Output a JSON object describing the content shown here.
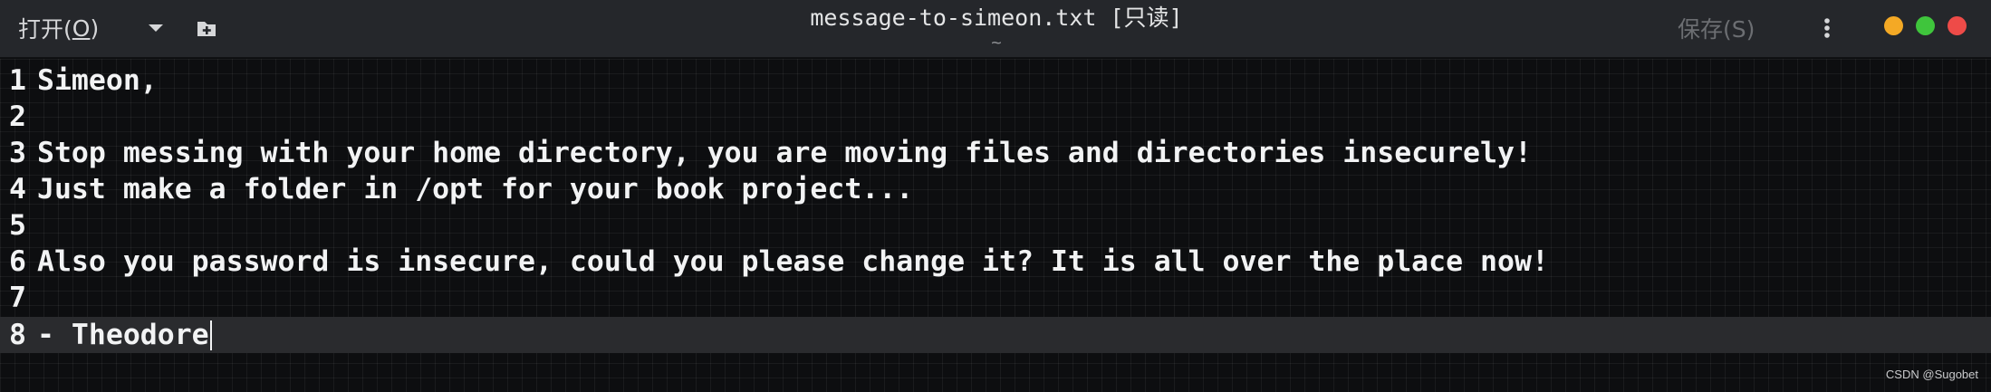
{
  "header": {
    "open_label_prefix": "打开(",
    "open_label_mnemonic": "O",
    "open_label_suffix": ")",
    "dropdown_icon": "chevron-down-icon",
    "new_tab_icon": "new-document-icon",
    "title": "message-to-simeon.txt [只读]",
    "subtitle": "~",
    "save_label": "保存(S)",
    "menu_icon": "vertical-ellipsis-icon"
  },
  "window_controls": {
    "minimize_color": "#f4a925",
    "maximize_color": "#3fc53c",
    "close_color": "#ee4b48"
  },
  "editor": {
    "lines": [
      {
        "number": "1",
        "text": "Simeon,"
      },
      {
        "number": "2",
        "text": ""
      },
      {
        "number": "3",
        "text": "Stop messing with your home directory, you are moving files and directories insecurely!"
      },
      {
        "number": "4",
        "text": "Just make a folder in /opt for your book project..."
      },
      {
        "number": "5",
        "text": ""
      },
      {
        "number": "6",
        "text": "Also you password is insecure, could you please change it? It is all over the place now!"
      },
      {
        "number": "7",
        "text": ""
      },
      {
        "number": "8",
        "text": "- Theodore"
      }
    ],
    "current_line": 8
  },
  "watermark": "CSDN @Sugobet"
}
